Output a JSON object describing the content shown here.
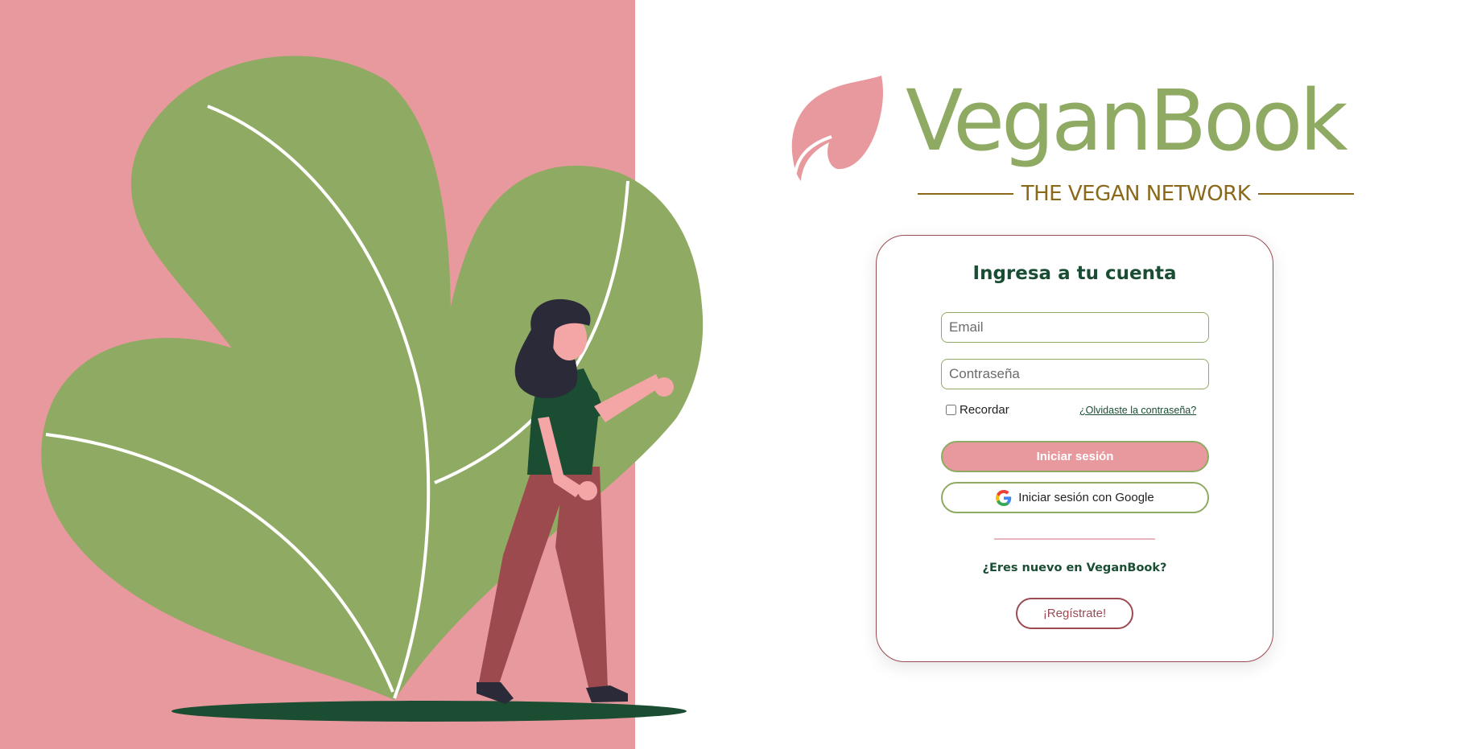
{
  "brand": {
    "name": "VeganBook",
    "tagline": "THE VEGAN NETWORK",
    "colors": {
      "pink": "#e8999e",
      "green": "#8faa63",
      "dark_green": "#1a4d33",
      "maroon": "#9c4a52",
      "gold": "#8a6a1a"
    }
  },
  "login": {
    "title": "Ingresa a tu cuenta",
    "email_placeholder": "Email",
    "password_placeholder": "Contraseña",
    "remember_label": "Recordar",
    "remember_checked": false,
    "forgot_link": "¿Olvidaste la contraseña?",
    "submit_label": "Iniciar sesión",
    "google_label": "Iniciar sesión con Google",
    "google_icon": "google-icon"
  },
  "register": {
    "question": "¿Eres nuevo en VeganBook?",
    "button_label": "¡Regístrate!"
  },
  "illustration": {
    "subject": "woman-walking-beside-large-leaves"
  }
}
